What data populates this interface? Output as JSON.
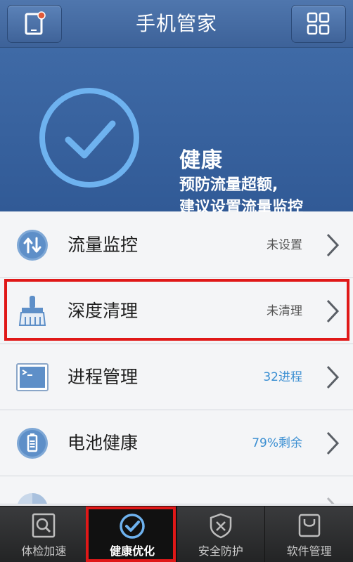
{
  "header": {
    "title": "手机管家",
    "left_icon": "phone-notification-icon",
    "right_icon": "grid-menu-icon",
    "notification_dot_color": "#e05a3a"
  },
  "status": {
    "title": "健康",
    "description_line1": "预防流量超额,",
    "description_line2": "建议设置流量监控",
    "icon": "check-circle-icon"
  },
  "list": [
    {
      "label": "流量监控",
      "value": "未设置",
      "icon": "traffic-arrows-icon",
      "value_color": "#555555"
    },
    {
      "label": "深度清理",
      "value": "未清理",
      "icon": "brush-icon",
      "value_color": "#555555"
    },
    {
      "label": "进程管理",
      "value": "32进程",
      "icon": "terminal-icon",
      "value_color": "#3b8fd2"
    },
    {
      "label": "电池健康",
      "value": "79%剩余",
      "icon": "battery-icon",
      "value_color": "#3b8fd2"
    }
  ],
  "tabs": [
    {
      "label": "体检加速",
      "icon": "magnifier-icon",
      "active": false
    },
    {
      "label": "健康优化",
      "icon": "check-circle-icon",
      "active": true
    },
    {
      "label": "安全防护",
      "icon": "shield-icon",
      "active": false
    },
    {
      "label": "软件管理",
      "icon": "bag-icon",
      "active": false
    }
  ],
  "colors": {
    "accent_blue": "#3b8fd2",
    "header_blue": "#3f6aa6",
    "highlight_red": "#e01818"
  }
}
